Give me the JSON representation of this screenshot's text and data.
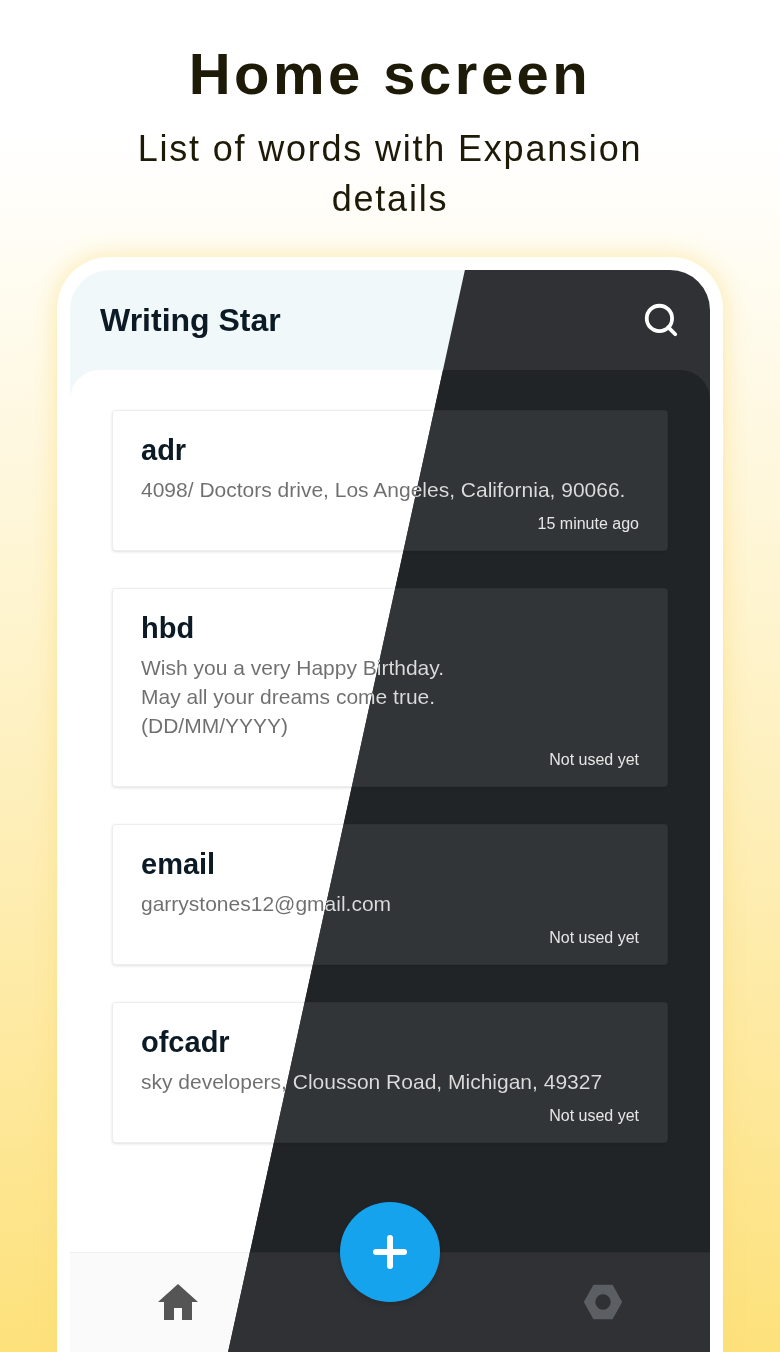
{
  "headline": "Home screen",
  "subheadline": "List of words with Expansion details",
  "app": {
    "title": "Writing Star"
  },
  "entries": [
    {
      "keyword": "adr",
      "expansion": "4098/ Doctors drive, Los Angeles, California, 90066.",
      "usage": "15 minute ago"
    },
    {
      "keyword": "hbd",
      "expansion": "Wish you a very Happy Birthday.\nMay all your dreams come true.\n(DD/MM/YYYY)",
      "usage": "Not used yet"
    },
    {
      "keyword": "email",
      "expansion": "garrystones12@gmail.com",
      "usage": "Not used yet"
    },
    {
      "keyword": "ofcadr",
      "expansion": "sky developers, Clousson Road, Michigan, 49327",
      "usage": "Not used yet"
    }
  ]
}
